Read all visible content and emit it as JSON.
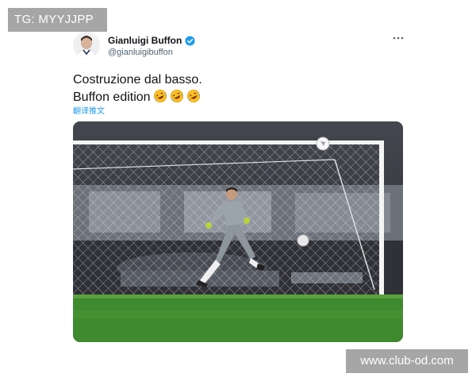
{
  "watermarks": {
    "top_left": "TG: MYYJJPP",
    "bottom_right": "www.club-od.com"
  },
  "tweet": {
    "author": {
      "display_name": "Gianluigi Buffon",
      "handle": "@gianluigibuffon",
      "verified": true
    },
    "text_line1": "Costruzione dal basso.",
    "text_line2": "Buffon edition",
    "emojis": [
      "rofl-emoji",
      "rofl-emoji",
      "rofl-emoji"
    ],
    "translate_label": "翻译推文",
    "media": {
      "description_icon": "photo-goalkeeper-kicking-ball"
    }
  },
  "colors": {
    "accent": "#1d9bf0",
    "verified": "#1d9bf0",
    "pitch": "#3f8a2e",
    "watermark_bg": "#a6a6a6"
  }
}
